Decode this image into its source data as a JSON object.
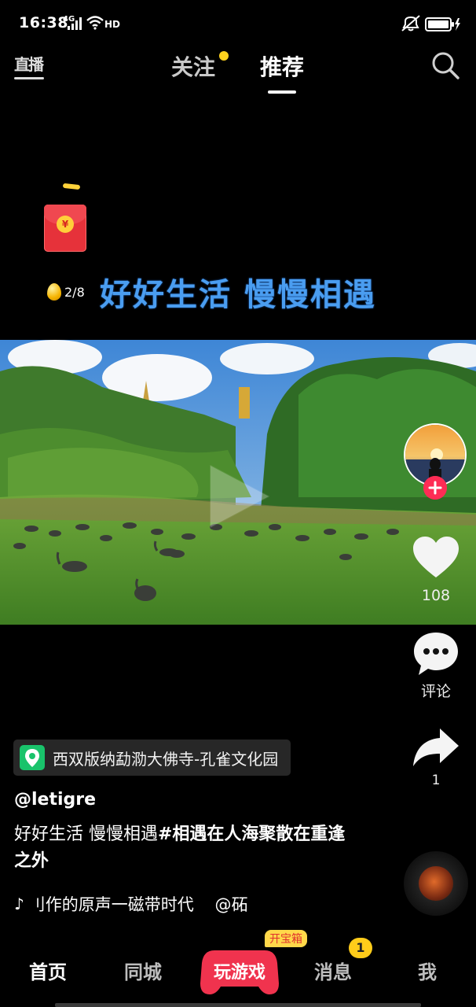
{
  "status_bar": {
    "time": "16:38",
    "network": "4G",
    "hd": "HD",
    "icons": [
      "signal-icon",
      "wifi-icon",
      "mute-icon",
      "battery-icon",
      "charging-icon"
    ]
  },
  "top_nav": {
    "live_label": "直播",
    "tabs": [
      {
        "label": "关注",
        "has_dot": true
      },
      {
        "label": "推荐",
        "active": true
      }
    ],
    "search_icon": "search-icon",
    "colors": {
      "active": "#ffffff",
      "inactive": "#c9c9c9",
      "dot": "#ffd21e"
    }
  },
  "red_packet": {
    "coin_symbol": "¥",
    "progress_text": "2/8"
  },
  "video": {
    "caption": "好好生活 慢慢相遇",
    "play_icon": "play-icon"
  },
  "actions": {
    "like_count": "108",
    "comment_label": "评论",
    "share_count": "1",
    "follow_icon": "plus-icon"
  },
  "info": {
    "location": "西双版纳勐泐大佛寺-孔雀文化园",
    "username": "@letigre",
    "description_text": "好好生活 慢慢相遇",
    "description_tags": "#相遇在人海聚散在重逢之外",
    "music": "刂作的原声一磁带时代    @砳"
  },
  "bottom_nav": {
    "home": "首页",
    "city": "同城",
    "game": "玩游戏",
    "treasure_badge": "开宝箱",
    "messages": "消息",
    "messages_badge": "1",
    "me": "我",
    "colors": {
      "game": "#f0334e",
      "badge": "#ffcc1a"
    }
  }
}
